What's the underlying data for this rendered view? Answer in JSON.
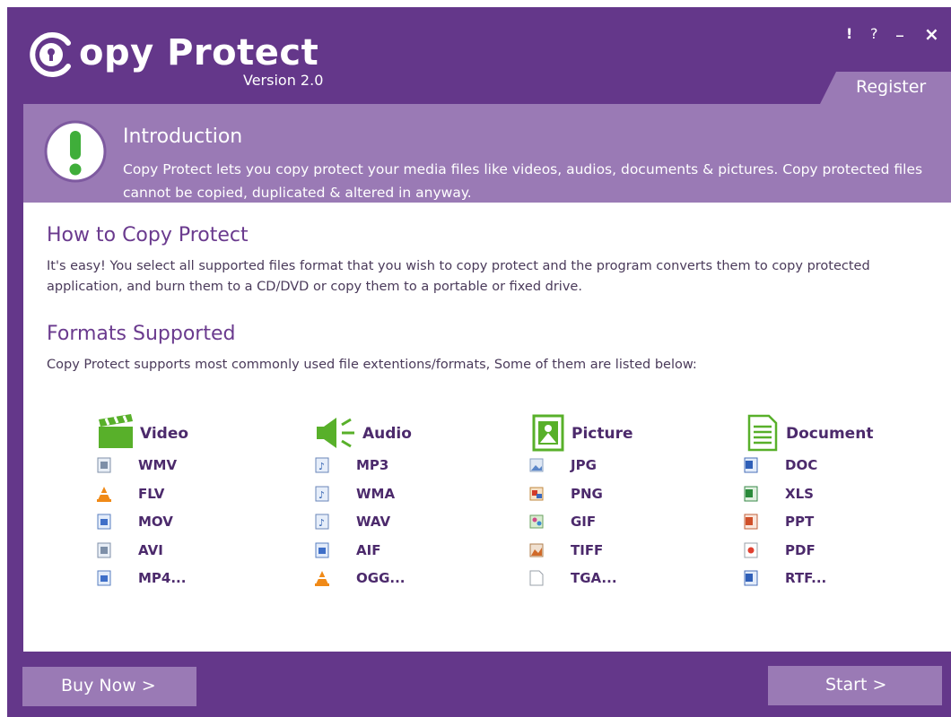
{
  "app": {
    "logo_text": "opy Protect",
    "version": "Version 2.0"
  },
  "window_controls": {
    "info": "!",
    "help": "?",
    "minimize": "_",
    "close": "×"
  },
  "register_tab": {
    "label": "Register"
  },
  "intro": {
    "title": "Introduction",
    "text": "Copy Protect lets you copy protect your media files like videos, audios, documents & pictures. Copy protected files cannot be copied, duplicated & altered in anyway."
  },
  "how_to": {
    "heading": "How to Copy Protect",
    "text": "It's easy! You select all supported files format that you wish to copy protect and the program converts them to copy protected application, and burn them to a CD/DVD or copy them to a portable or fixed drive."
  },
  "formats": {
    "heading": "Formats Supported",
    "text": "Copy Protect supports most commonly used file extentions/formats, Some of them are listed below:",
    "video": {
      "title": "Video",
      "icon": "clapperboard-icon",
      "items": [
        "WMV",
        "FLV",
        "MOV",
        "AVI",
        "MP4..."
      ]
    },
    "audio": {
      "title": "Audio",
      "icon": "speaker-icon",
      "items": [
        "MP3",
        "WMA",
        "WAV",
        "AIF",
        "OGG..."
      ]
    },
    "picture": {
      "title": "Picture",
      "icon": "picture-icon",
      "items": [
        "JPG",
        "PNG",
        "GIF",
        "TIFF",
        "TGA..."
      ]
    },
    "document": {
      "title": "Document",
      "icon": "document-icon",
      "items": [
        "DOC",
        "XLS",
        "PPT",
        "PDF",
        "RTF..."
      ]
    }
  },
  "buttons": {
    "buy_now": "Buy Now >",
    "start": "Start >"
  },
  "colors": {
    "window_bg": "#64378a",
    "panel_accent": "#9a7ab5",
    "heading": "#6a3a8e",
    "label": "#4c2a6c",
    "alert_green": "#3fae3a"
  }
}
